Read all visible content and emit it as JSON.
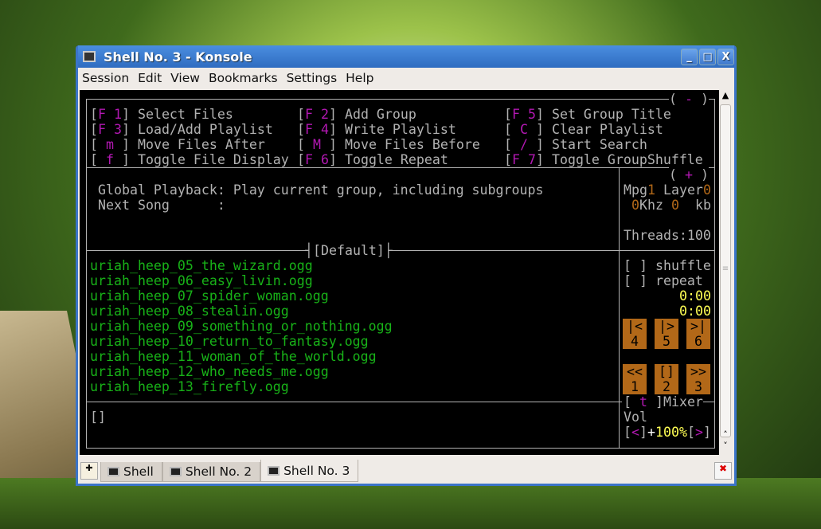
{
  "window": {
    "title": "Shell No. 3 - Konsole",
    "minimize": "_",
    "maximize": "□",
    "close": "X"
  },
  "menu": [
    "Session",
    "Edit",
    "View",
    "Bookmarks",
    "Settings",
    "Help"
  ],
  "help": {
    "collapse": "-",
    "expand": "+",
    "rows": [
      [
        {
          "k": "F 1",
          "l": "Select Files"
        },
        {
          "k": "F 2",
          "l": "Add Group"
        },
        {
          "k": "F 5",
          "l": "Set Group Title"
        }
      ],
      [
        {
          "k": "F 3",
          "l": "Load/Add Playlist"
        },
        {
          "k": "F 4",
          "l": "Write Playlist"
        },
        {
          "k": " C ",
          "l": "Clear Playlist"
        }
      ],
      [
        {
          "k": " m ",
          "l": "Move Files After"
        },
        {
          "k": " M ",
          "l": "Move Files Before"
        },
        {
          "k": " / ",
          "l": "Start Search"
        }
      ],
      [
        {
          "k": " f ",
          "l": "Toggle File Display"
        },
        {
          "k": "F 6",
          "l": "Toggle Repeat"
        },
        {
          "k": "F 7",
          "l": "Toggle GroupShuffle"
        }
      ]
    ]
  },
  "playback": {
    "global": "Global Playback: Play current group, including subgroups",
    "next": "Next Song      :"
  },
  "info": {
    "mpg_label": "Mpg",
    "mpg": "1",
    "layer_label": " Layer",
    "layer": "0",
    "khz": "0",
    "khz_label": "Khz ",
    "kb": "0",
    "kb_label": "  kb",
    "threads": "Threads:100"
  },
  "group": "[Default]",
  "playlist": [
    "uriah_heep_05_the_wizard.ogg",
    "uriah_heep_06_easy_livin.ogg",
    "uriah_heep_07_spider_woman.ogg",
    "uriah_heep_08_stealin.ogg",
    "uriah_heep_09_something_or_nothing.ogg",
    "uriah_heep_10_return_to_fantasy.ogg",
    "uriah_heep_11_woman_of_the_world.ogg",
    "uriah_heep_12_who_needs_me.ogg",
    "uriah_heep_13_firefly.ogg"
  ],
  "input": "[]",
  "controls": {
    "shuffle": "[ ] shuffle",
    "repeat": "[ ] repeat",
    "elapsed": "0:00",
    "total": "0:00",
    "buttons": [
      {
        "s": "|<",
        "n": "4"
      },
      {
        "s": "|>",
        "n": "5"
      },
      {
        "s": ">|",
        "n": "6"
      },
      {
        "s": "<<",
        "n": "1"
      },
      {
        "s": "[]",
        "n": "2"
      },
      {
        "s": ">>",
        "n": "3"
      }
    ]
  },
  "mixer": {
    "key": "t",
    "label": "]Mixer",
    "vol": "Vol",
    "down": "<",
    "up": ">",
    "sign": "+",
    "level": "100%"
  },
  "tabs": [
    "Shell",
    "Shell No. 2",
    "Shell No. 3"
  ],
  "colors": {
    "key": "#b218b2",
    "file": "#18b218",
    "time": "#ffff54",
    "button": "#b26818"
  }
}
